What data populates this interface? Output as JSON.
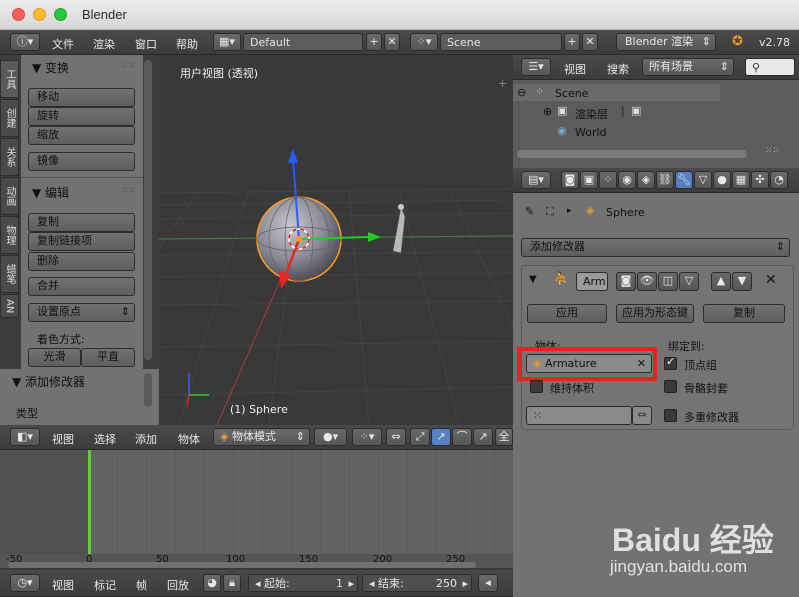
{
  "window": {
    "title": "Blender"
  },
  "top_menu": {
    "items": [
      "文件",
      "渲染",
      "窗口",
      "帮助"
    ],
    "layout": "Default",
    "scene": "Scene",
    "engine": "Blender 渲染",
    "version": "v2.78"
  },
  "left_tabs": [
    "工具",
    "创建",
    "关系",
    "动画",
    "物理",
    "蜡笔",
    "AN"
  ],
  "tools": {
    "transform_header": "▼ 变换",
    "move": "移动",
    "rotate": "旋转",
    "scale": "缩放",
    "mirror": "镜像",
    "edit_header": "▼ 编辑",
    "duplicate": "复制",
    "duplicate_linked": "复制链接项",
    "delete": "删除",
    "join": "合并",
    "set_origin": "设置原点",
    "shading_label": "着色方式:",
    "smooth": "光滑",
    "flat": "平直"
  },
  "add_modifier_panel": {
    "header": "▼ 添加修改器",
    "type_label": "类型"
  },
  "viewport": {
    "view_label": "用户视图 (透视)",
    "object_label": "(1) Sphere"
  },
  "view3d_header": {
    "items": [
      "视图",
      "选择",
      "添加",
      "物体"
    ],
    "mode": "物体模式",
    "global": "全"
  },
  "outliner": {
    "menu_view": "视图",
    "menu_search": "搜索",
    "filter": "所有场景",
    "tree": [
      {
        "label": "Scene"
      },
      {
        "label": "渲染层"
      },
      {
        "label": "World"
      }
    ]
  },
  "properties": {
    "breadcrumb_object": "Sphere",
    "add_modifier": "添加修改器",
    "mod_name": "Arm",
    "apply": "应用",
    "apply_as_shape": "应用为形态键",
    "copy": "复制",
    "object_label": "物体:",
    "bind_label": "绑定到:",
    "object_value": "Armature",
    "vertex_groups": "顶点组",
    "preserve_volume": "维持体积",
    "bone_envelopes": "骨骼封套",
    "multi_modifier": "多重修改器"
  },
  "timeline": {
    "ticks": [
      "-50",
      "0",
      "50",
      "100",
      "150",
      "200",
      "250"
    ],
    "current_frame": 0,
    "menu": [
      "视图",
      "标记",
      "帧",
      "回放"
    ],
    "start_label": "起始:",
    "start_value": "1",
    "end_label": "结束:",
    "end_value": "250"
  },
  "watermark": {
    "brand": "Baidu 经验",
    "url": "jingyan.baidu.com"
  },
  "colors": {
    "accent": "#5680c2",
    "highlight_box": "#e8231b",
    "timeline_cursor": "#66cc33",
    "selection_orange": "#ff9a1e"
  }
}
